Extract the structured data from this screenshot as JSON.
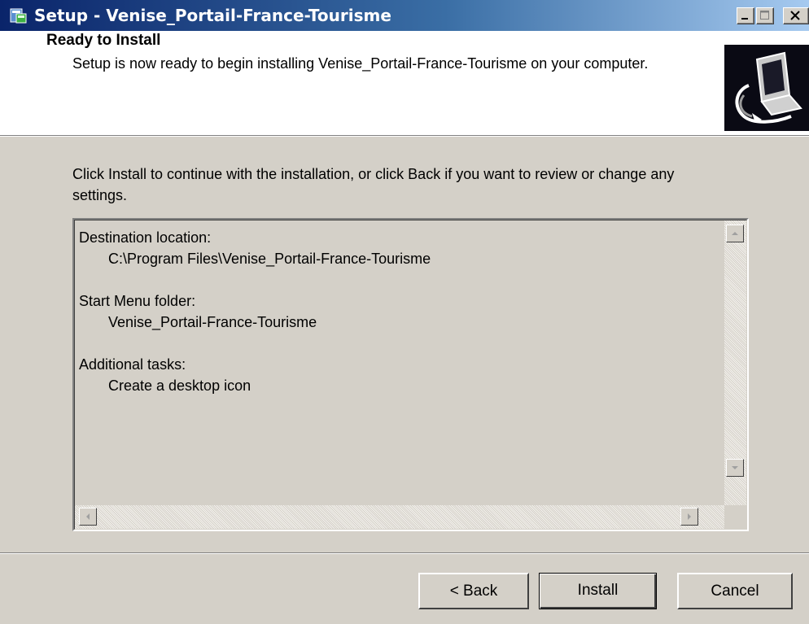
{
  "window": {
    "title": "Setup - Venise_Portail-France-Tourisme",
    "icon": "setup-icon",
    "controls": [
      "minimize-icon",
      "maximize-icon",
      "close-icon"
    ]
  },
  "header": {
    "title": "Ready to Install",
    "description": "Setup is now ready to begin installing Venise_Portail-France-Tourisme on your computer.",
    "image": "computer-install-icon"
  },
  "body": {
    "instruction": "Click Install to continue with the installation, or click Back if you want to review or change any settings.",
    "memo": {
      "destination_label": "Destination location:",
      "destination_value": "C:\\Program Files\\Venise_Portail-France-Tourisme",
      "startmenu_label": "Start Menu folder:",
      "startmenu_value": "Venise_Portail-France-Tourisme",
      "tasks_label": "Additional tasks:",
      "tasks_value": "Create a desktop icon"
    }
  },
  "buttons": {
    "back": "< Back",
    "install": "Install",
    "cancel": "Cancel"
  },
  "colors": {
    "titlebar_start": "#0a246a",
    "titlebar_end": "#a6caf0",
    "face": "#d4d0c8",
    "header_bg": "#ffffff"
  }
}
